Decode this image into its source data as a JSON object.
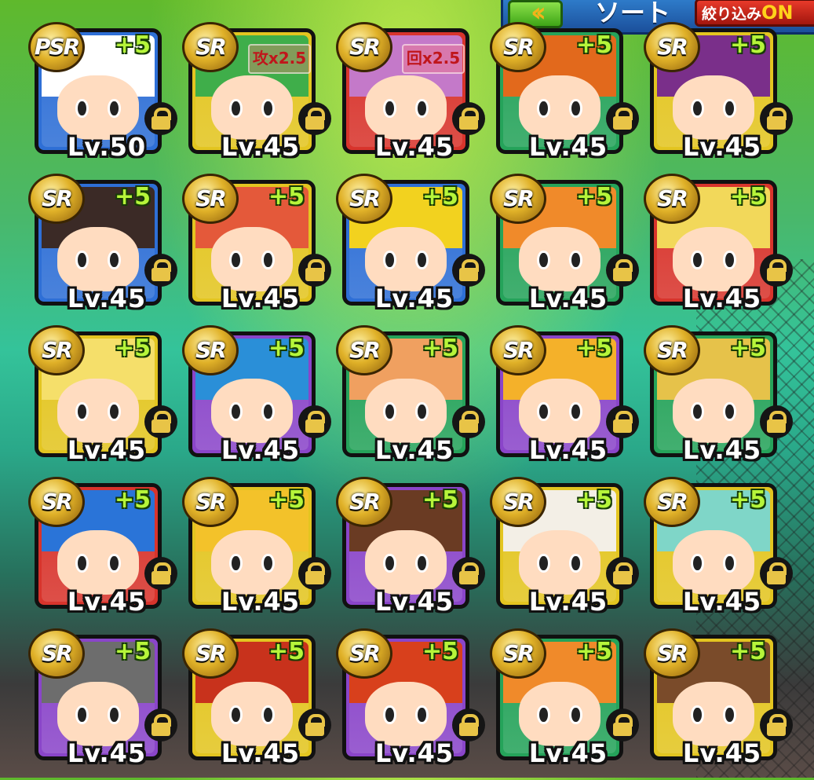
{
  "header": {
    "back_icon": "double-chevron-left-icon",
    "sort_label": "ソート",
    "filter_label": "絞り込み",
    "filter_state": "ON"
  },
  "cards": [
    {
      "rank": "PSR",
      "plus": "+5",
      "level": "Lv.50",
      "frame": "#2e6fd6",
      "hair": "#ffffff",
      "locked": true
    },
    {
      "rank": "SR",
      "plus": "",
      "boost": "攻x2.5",
      "level": "Lv.45",
      "frame": "#e3c520",
      "hair": "#3fae4a",
      "locked": true
    },
    {
      "rank": "SR",
      "plus": "",
      "boost": "回x2.5",
      "level": "Lv.45",
      "frame": "#d8342c",
      "hair": "#c479c9",
      "locked": true
    },
    {
      "rank": "SR",
      "plus": "+5",
      "level": "Lv.45",
      "frame": "#25a35a",
      "hair": "#e2691c",
      "locked": true
    },
    {
      "rank": "SR",
      "plus": "+5",
      "level": "Lv.45",
      "frame": "#e3c520",
      "hair": "#7a2f8a",
      "locked": true
    },
    {
      "rank": "SR",
      "plus": "+5",
      "level": "Lv.45",
      "frame": "#2e6fd6",
      "hair": "#3b2a26",
      "locked": true
    },
    {
      "rank": "SR",
      "plus": "+5",
      "level": "Lv.45",
      "frame": "#e3c520",
      "hair": "#e4593a",
      "locked": true
    },
    {
      "rank": "SR",
      "plus": "+5",
      "level": "Lv.45",
      "frame": "#2e6fd6",
      "hair": "#f2d21f",
      "locked": true
    },
    {
      "rank": "SR",
      "plus": "+5",
      "level": "Lv.45",
      "frame": "#25a35a",
      "hair": "#f08a2a",
      "locked": true
    },
    {
      "rank": "SR",
      "plus": "+5",
      "level": "Lv.45",
      "frame": "#d8342c",
      "hair": "#f2d85a",
      "locked": true
    },
    {
      "rank": "SR",
      "plus": "+5",
      "level": "Lv.45",
      "frame": "#e3c520",
      "hair": "#f5df6a",
      "locked": true
    },
    {
      "rank": "SR",
      "plus": "+5",
      "level": "Lv.45",
      "frame": "#8a45c9",
      "hair": "#2a8fd8",
      "locked": true
    },
    {
      "rank": "SR",
      "plus": "+5",
      "level": "Lv.45",
      "frame": "#25a35a",
      "hair": "#f0a060",
      "locked": true
    },
    {
      "rank": "SR",
      "plus": "+5",
      "level": "Lv.45",
      "frame": "#8a45c9",
      "hair": "#f4b12a",
      "locked": true
    },
    {
      "rank": "SR",
      "plus": "+5",
      "level": "Lv.45",
      "frame": "#25a35a",
      "hair": "#e6c24a",
      "locked": true
    },
    {
      "rank": "SR",
      "plus": "+5",
      "level": "Lv.45",
      "frame": "#d8342c",
      "hair": "#2a74d8",
      "locked": true
    },
    {
      "rank": "SR",
      "plus": "+5",
      "level": "Lv.45",
      "frame": "#e3c520",
      "hair": "#f3c22a",
      "locked": true
    },
    {
      "rank": "SR",
      "plus": "+5",
      "level": "Lv.45",
      "frame": "#8a45c9",
      "hair": "#6a3b23",
      "locked": true
    },
    {
      "rank": "SR",
      "plus": "+5",
      "level": "Lv.45",
      "frame": "#e3c520",
      "hair": "#f3efe6",
      "locked": true
    },
    {
      "rank": "SR",
      "plus": "+5",
      "level": "Lv.45",
      "frame": "#e3c520",
      "hair": "#7fd6c8",
      "locked": true
    },
    {
      "rank": "SR",
      "plus": "+5",
      "level": "Lv.45",
      "frame": "#8a45c9",
      "hair": "#6d6d6d",
      "locked": true
    },
    {
      "rank": "SR",
      "plus": "+5",
      "level": "Lv.45",
      "frame": "#e3c520",
      "hair": "#c8321c",
      "locked": true
    },
    {
      "rank": "SR",
      "plus": "+5",
      "level": "Lv.45",
      "frame": "#8a45c9",
      "hair": "#d8401c",
      "locked": true
    },
    {
      "rank": "SR",
      "plus": "+5",
      "level": "Lv.45",
      "frame": "#25a35a",
      "hair": "#f08a2a",
      "locked": true
    },
    {
      "rank": "SR",
      "plus": "+5",
      "level": "Lv.45",
      "frame": "#e3c520",
      "hair": "#7a4b2a",
      "locked": true
    }
  ]
}
